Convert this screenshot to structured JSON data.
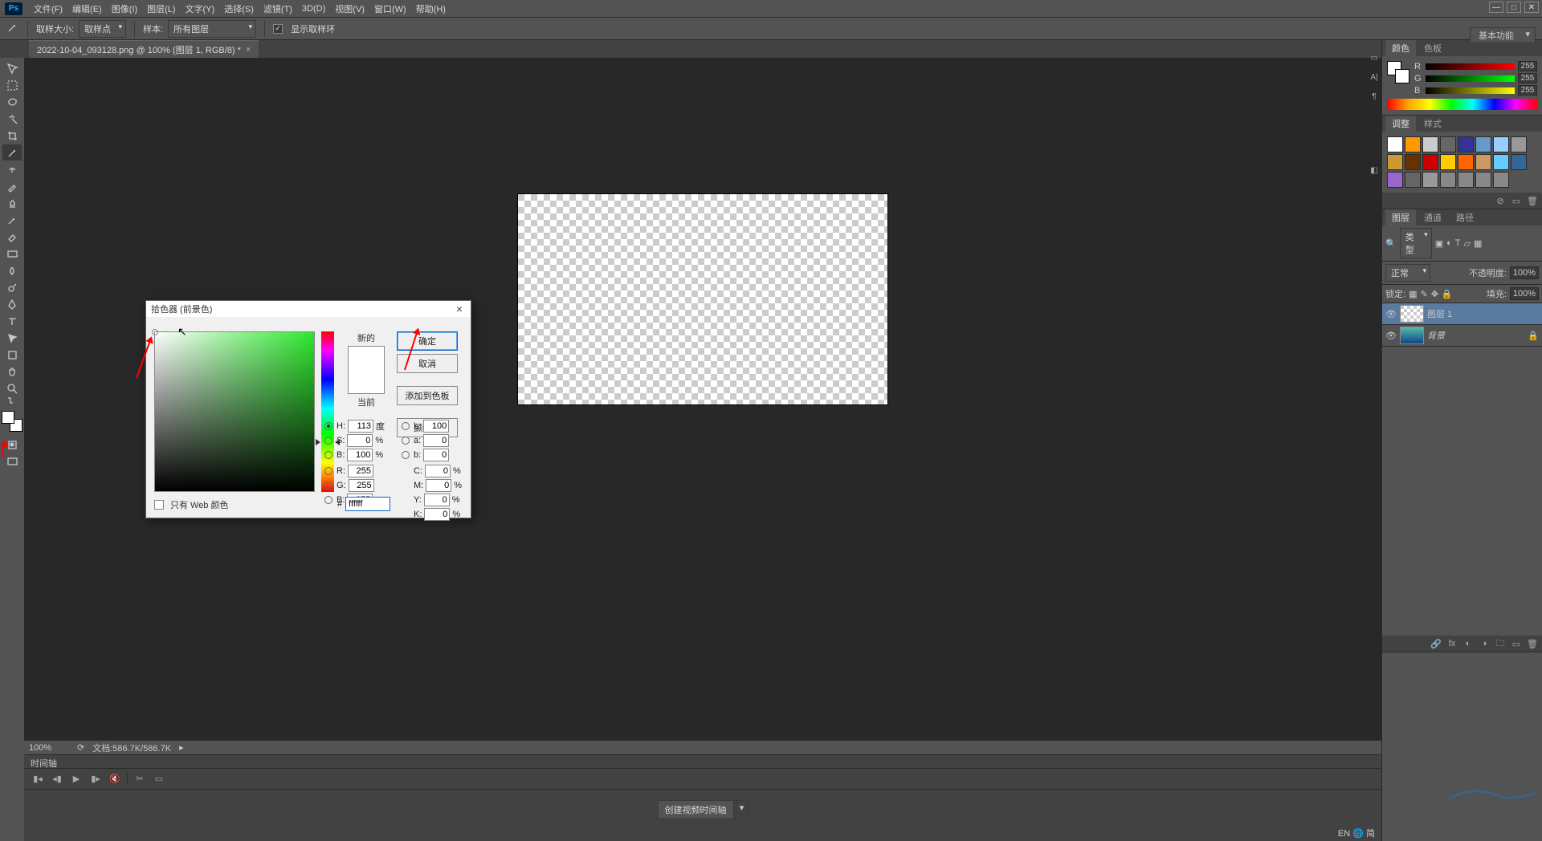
{
  "menu": {
    "items": [
      "文件(F)",
      "编辑(E)",
      "图像(I)",
      "图层(L)",
      "文字(Y)",
      "选择(S)",
      "滤镜(T)",
      "3D(D)",
      "视图(V)",
      "窗口(W)",
      "帮助(H)"
    ]
  },
  "options": {
    "sample_size_label": "取样大小:",
    "sample_size_value": "取样点",
    "sample_label": "样本:",
    "sample_value": "所有图层",
    "show_ring_label": "显示取样环"
  },
  "doc_tab": {
    "title": "2022-10-04_093128.png @ 100% (图层 1, RGB/8) *"
  },
  "workspace_switcher": "基本功能",
  "color_panel": {
    "tab1": "颜色",
    "tab2": "色板",
    "r_label": "R",
    "g_label": "G",
    "b_label": "B",
    "r": "255",
    "g": "255",
    "b": "255"
  },
  "adjust_panel": {
    "tab1": "调整",
    "tab2": "样式"
  },
  "layers_panel": {
    "tab1": "图层",
    "tab2": "通道",
    "tab3": "路径",
    "filter_label": "类型",
    "blend_mode": "正常",
    "opacity_label": "不透明度:",
    "opacity": "100%",
    "lock_label": "锁定:",
    "fill_label": "填充:",
    "fill": "100%",
    "layer1": "图层 1",
    "layer_bg": "背景"
  },
  "status": {
    "zoom": "100%",
    "doc": "文档:586.7K/586.7K"
  },
  "timeline": {
    "tab": "时间轴",
    "create_btn": "创建视频时间轴"
  },
  "picker": {
    "title": "拾色器 (前景色)",
    "new_label": "新的",
    "current_label": "当前",
    "ok": "确定",
    "cancel": "取消",
    "add_swatch": "添加到色板",
    "libraries": "颜色库",
    "web_only": "只有 Web 颜色",
    "H_label": "H:",
    "S_label": "S:",
    "Bv_label": "B:",
    "R_label": "R:",
    "G_label": "G:",
    "B_label": "B:",
    "L_label": "L:",
    "a_label": "a:",
    "b2_label": "b:",
    "C_label": "C:",
    "M_label": "M:",
    "Y_label": "Y:",
    "K_label": "K:",
    "deg": "度",
    "pct": "%",
    "H": "113",
    "S": "0",
    "Bv": "100",
    "R": "255",
    "G": "255",
    "B": "255",
    "L": "100",
    "a": "0",
    "b2": "0",
    "C": "0",
    "M": "0",
    "Y": "0",
    "K": "0",
    "hex_label": "#",
    "hex": "ffffff"
  },
  "ime": "EN 🌐 简",
  "swatch_colors": [
    "#ffffff",
    "#ff9900",
    "#cccccc",
    "#666666",
    "#333399",
    "#6699cc",
    "#99ccff",
    "#999999",
    "#cc9933",
    "#663300",
    "#cc0000",
    "#ffcc00",
    "#ff6600",
    "#cc9966",
    "#66ccff",
    "#336699",
    "#9966cc",
    "#666666",
    "#999999",
    "#888888",
    "#888888",
    "#888888",
    "#888888"
  ]
}
